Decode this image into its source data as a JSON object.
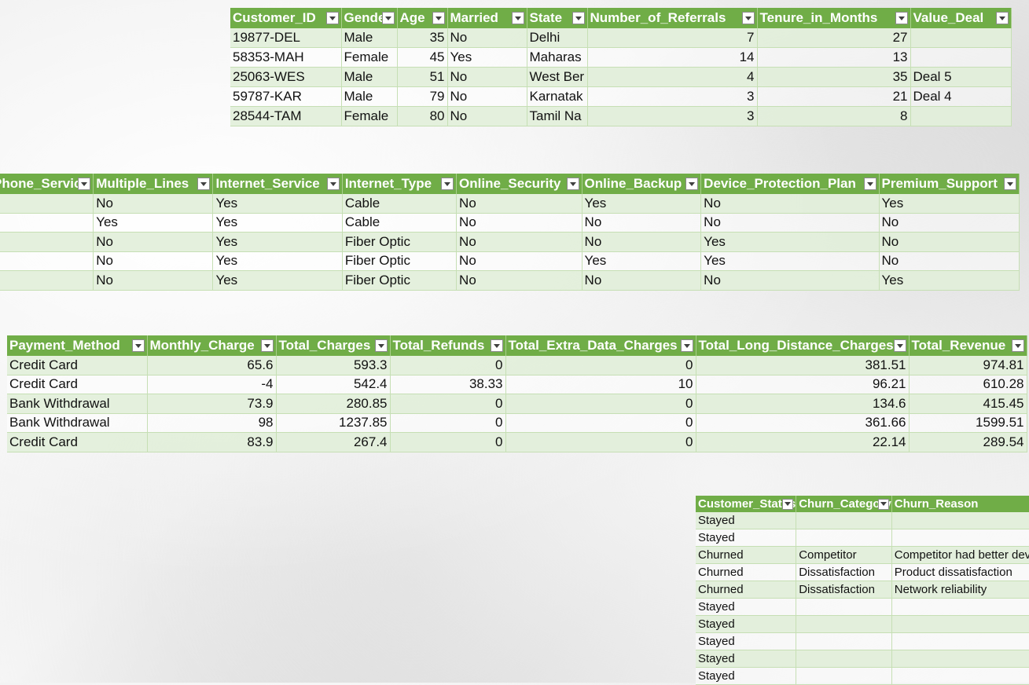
{
  "table1": {
    "headers": [
      "Customer_ID",
      "Gender",
      "Age",
      "Married",
      "State",
      "Number_of_Referrals",
      "Tenure_in_Months",
      "Value_Deal"
    ],
    "rows": [
      [
        "19877-DEL",
        "Male",
        "35",
        "No",
        "Delhi",
        "7",
        "27",
        ""
      ],
      [
        "58353-MAH",
        "Female",
        "45",
        "Yes",
        "Maharas",
        "14",
        "13",
        ""
      ],
      [
        "25063-WES",
        "Male",
        "51",
        "No",
        "West Ber",
        "4",
        "35",
        "Deal 5"
      ],
      [
        "59787-KAR",
        "Male",
        "79",
        "No",
        "Karnatak",
        "3",
        "21",
        "Deal 4"
      ],
      [
        "28544-TAM",
        "Female",
        "80",
        "No",
        "Tamil Na",
        "3",
        "8",
        ""
      ]
    ]
  },
  "table2": {
    "headers": [
      "Phone_Service",
      "Multiple_Lines",
      "Internet_Service",
      "Internet_Type",
      "Online_Security",
      "Online_Backup",
      "Device_Protection_Plan",
      "Premium_Support"
    ],
    "rows": [
      [
        "",
        "No",
        "Yes",
        "Cable",
        "No",
        "Yes",
        "No",
        "Yes"
      ],
      [
        "",
        "Yes",
        "Yes",
        "Cable",
        "No",
        "No",
        "No",
        "No"
      ],
      [
        "",
        "No",
        "Yes",
        "Fiber Optic",
        "No",
        "No",
        "Yes",
        "No"
      ],
      [
        "",
        "No",
        "Yes",
        "Fiber Optic",
        "No",
        "Yes",
        "Yes",
        "No"
      ],
      [
        "",
        "No",
        "Yes",
        "Fiber Optic",
        "No",
        "No",
        "No",
        "Yes"
      ]
    ]
  },
  "table3": {
    "headers": [
      "Payment_Method",
      "Monthly_Charge",
      "Total_Charges",
      "Total_Refunds",
      "Total_Extra_Data_Charges",
      "Total_Long_Distance_Charges",
      "Total_Revenue"
    ],
    "rows": [
      [
        "Credit Card",
        "65.6",
        "593.3",
        "0",
        "0",
        "381.51",
        "974.81"
      ],
      [
        "Credit Card",
        "-4",
        "542.4",
        "38.33",
        "10",
        "96.21",
        "610.28"
      ],
      [
        "Bank Withdrawal",
        "73.9",
        "280.85",
        "0",
        "0",
        "134.6",
        "415.45"
      ],
      [
        "Bank Withdrawal",
        "98",
        "1237.85",
        "0",
        "0",
        "361.66",
        "1599.51"
      ],
      [
        "Credit Card",
        "83.9",
        "267.4",
        "0",
        "0",
        "22.14",
        "289.54"
      ]
    ]
  },
  "table4": {
    "headers": [
      "Customer_Status",
      "Churn_Category",
      "Churn_Reason"
    ],
    "rows": [
      [
        "Stayed",
        "",
        ""
      ],
      [
        "Stayed",
        "",
        ""
      ],
      [
        "Churned",
        "Competitor",
        "Competitor had better devices"
      ],
      [
        "Churned",
        "Dissatisfaction",
        "Product dissatisfaction"
      ],
      [
        "Churned",
        "Dissatisfaction",
        "Network reliability"
      ],
      [
        "Stayed",
        "",
        ""
      ],
      [
        "Stayed",
        "",
        ""
      ],
      [
        "Stayed",
        "",
        ""
      ],
      [
        "Stayed",
        "",
        ""
      ],
      [
        "Stayed",
        "",
        ""
      ]
    ]
  },
  "colors": {
    "header_green": "#70ad47",
    "band_light_green": "#e2efda",
    "header_text": "#ffffff"
  },
  "icons": {
    "filter_dropdown": "filter-dropdown-icon"
  }
}
